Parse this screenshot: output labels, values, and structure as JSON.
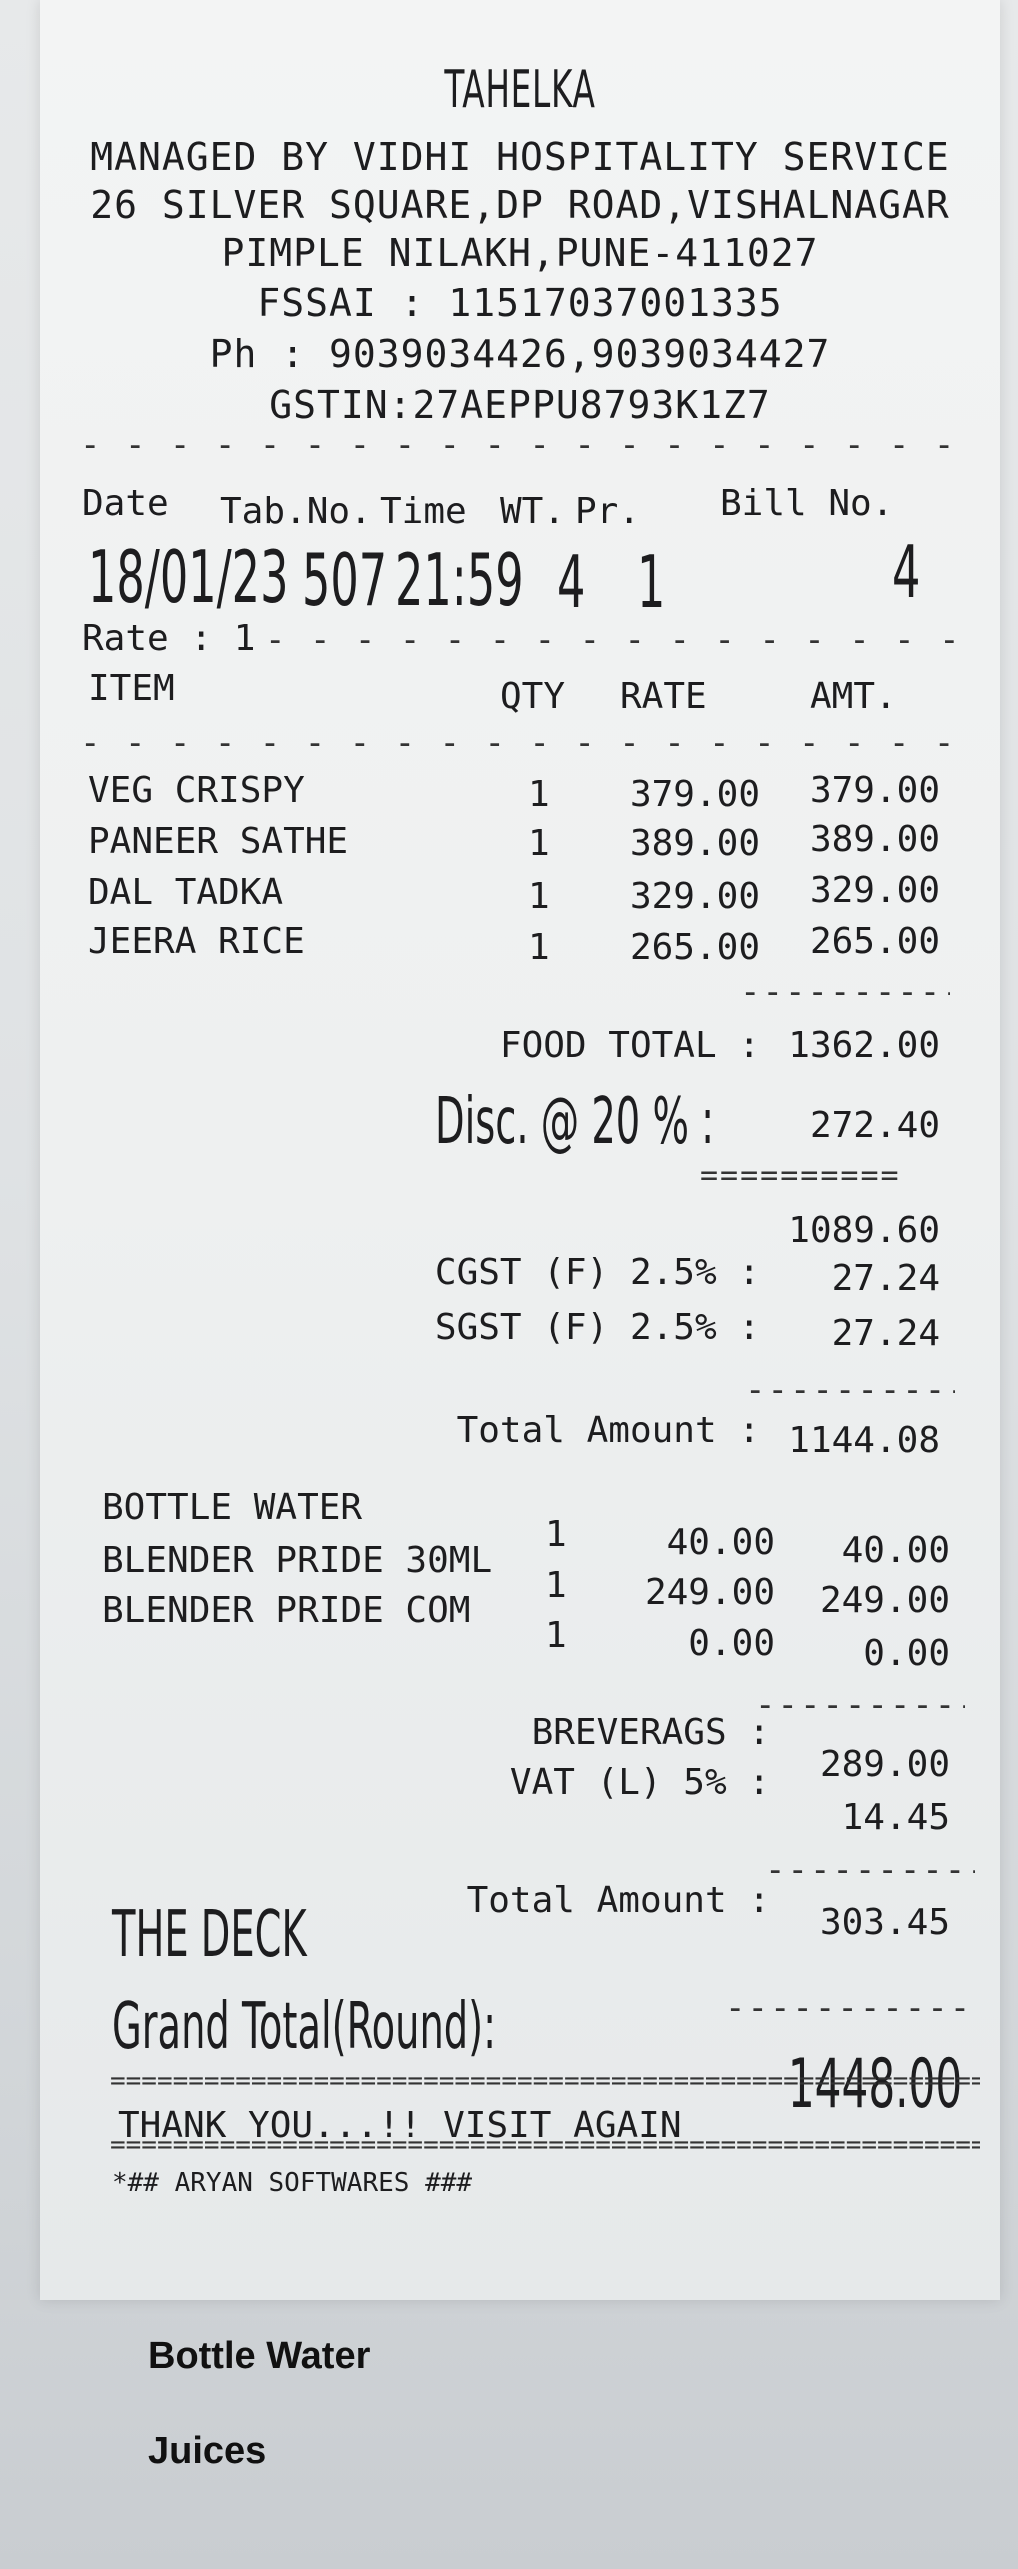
{
  "header": {
    "name": "TAHELKA",
    "lines": [
      "MANAGED BY VIDHI HOSPITALITY SERVICE",
      "26 SILVER SQUARE,DP ROAD,VISHALNAGAR",
      "PIMPLE NILAKH,PUNE-411027",
      "FSSAI : 11517037001335",
      "Ph : 9039034426,9039034427",
      "GSTIN:27AEPPU8793K1Z7"
    ]
  },
  "meta": {
    "labels": {
      "date": "Date",
      "table": "Tab.No.",
      "time": "Time",
      "wt": "WT.",
      "pr": "Pr.",
      "bill": "Bill No."
    },
    "values": {
      "date": "18/01/23",
      "table": "507",
      "time": "21:59",
      "wt": "4",
      "pr": "1",
      "bill": "4"
    },
    "rate": "Rate : 1"
  },
  "columns": {
    "item": "ITEM",
    "qty": "QTY",
    "rate": "RATE",
    "amt": "AMT."
  },
  "food_items": [
    {
      "name": "VEG CRISPY",
      "qty": "1",
      "rate": "379.00",
      "amt": "379.00"
    },
    {
      "name": "PANEER SATHE",
      "qty": "1",
      "rate": "389.00",
      "amt": "389.00"
    },
    {
      "name": "DAL TADKA",
      "qty": "1",
      "rate": "329.00",
      "amt": "329.00"
    },
    {
      "name": "JEERA RICE",
      "qty": "1",
      "rate": "265.00",
      "amt": "265.00"
    }
  ],
  "food_summary": {
    "food_total_label": "FOOD TOTAL :",
    "food_total": "1362.00",
    "disc_label": "Disc. @ 20 % :",
    "disc": "272.40",
    "subtotal": "1089.60",
    "cgst_label": "CGST (F)  2.5% :",
    "cgst": "27.24",
    "sgst_label": "SGST (F)  2.5% :",
    "sgst": "27.24",
    "total_label": "Total Amount :",
    "total": "1144.08"
  },
  "bev_items": [
    {
      "name": "BOTTLE WATER",
      "qty": "1",
      "rate": "40.00",
      "amt": "40.00"
    },
    {
      "name": "BLENDER PRIDE 30ML",
      "qty": "1",
      "rate": "249.00",
      "amt": "249.00"
    },
    {
      "name": "BLENDER PRIDE COM",
      "qty": "1",
      "rate": "0.00",
      "amt": "0.00"
    }
  ],
  "bev_summary": {
    "bev_label": "BREVERAGS :",
    "bev": "289.00",
    "vat_label": "VAT (L)    5% :",
    "vat": "14.45",
    "total_label": "Total Amount :",
    "total": "303.45"
  },
  "footer": {
    "deck": "THE DECK",
    "grand_label": "Grand Total(Round):",
    "grand": "1448.00",
    "thanks": "THANK YOU...!! VISIT AGAIN",
    "software": "*## ARYAN SOFTWARES ###"
  },
  "below_receipt": [
    "Bottle Water",
    "Juices"
  ]
}
